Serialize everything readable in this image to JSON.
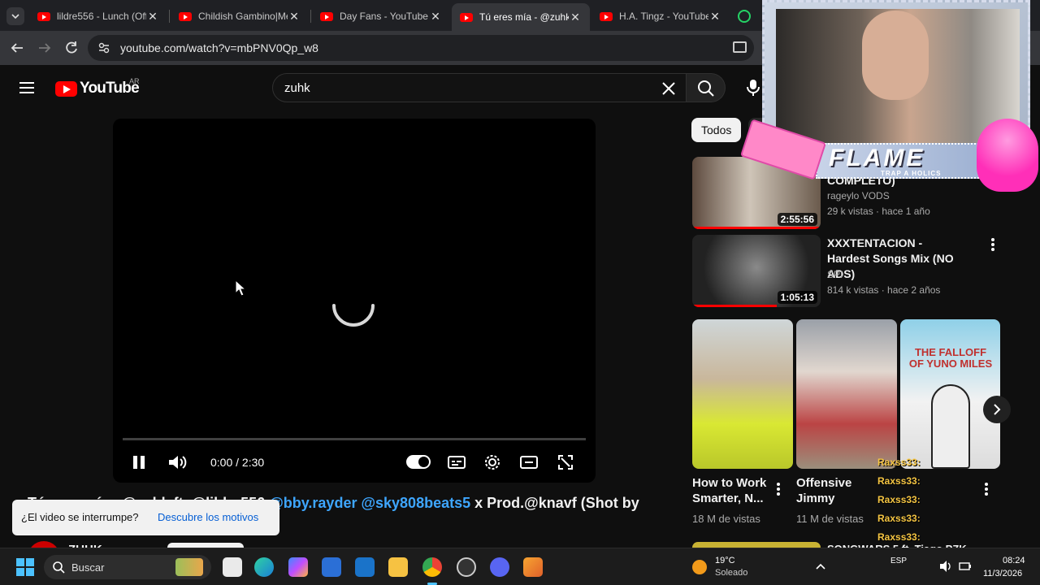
{
  "browser": {
    "tabs": [
      {
        "label": "lildre556 - Lunch (Off",
        "active": false
      },
      {
        "label": "Childish Gambino|Me",
        "active": false
      },
      {
        "label": "Day Fans - YouTube",
        "active": false
      },
      {
        "label": "Tú eres mía - @zuhk",
        "active": true
      },
      {
        "label": "H.A. Tingz - YouTube",
        "active": false
      }
    ],
    "url": "youtube.com/watch?v=mbPNV0Qp_w8"
  },
  "youtube": {
    "logo_text": "YouTube",
    "region": "AR",
    "search_value": "zuhk"
  },
  "player": {
    "time": "0:00 / 2:30",
    "progress": 0
  },
  "video": {
    "title_prefix": "Tú eres mía - @zuhk ft. @lildre556",
    "title_links": "@bby.rayder @sky808beats5",
    "title_suffix": "x Prod.@knavf (Shot by",
    "channel": "ZUHK"
  },
  "toast": {
    "message": "¿El video se interrumpe?",
    "action": "Descubre los motivos"
  },
  "sidebar": {
    "chip_all": "Todos",
    "videos": [
      {
        "title": "COMPLETO)",
        "channel": "rageylo VODS",
        "meta": "29 k vistas · hace 1 año",
        "duration": "2:55:56"
      },
      {
        "title": "XXXTENTACION - Hardest Songs Mix (NO ADS)",
        "channel": "SPI",
        "meta": "814 k vistas · hace 2 años",
        "duration": "1:05:13"
      }
    ],
    "shorts": [
      {
        "title": "How to Work Smarter, N...",
        "meta": "18 M de vistas"
      },
      {
        "title": "Offensive Jimmy",
        "meta": "11 M de vistas"
      },
      {
        "title": "The Falloff of Yuno Miles",
        "thumb_text": "THE FALLOFF OF YUNO MILES"
      }
    ],
    "next_title": "SONGWARS 5 ft. Tiago PZK"
  },
  "overlay": {
    "stream_logo": "FLAME",
    "stream_sub": "TRAP A HOLICS",
    "chat_user": "Raxss33:"
  },
  "taskbar": {
    "search_placeholder": "Buscar",
    "weather_temp": "19°C",
    "weather_desc": "Soleado",
    "lang": "ESP",
    "time": "08:24",
    "date": "11/3/2026"
  },
  "colors": {
    "yt_red": "#ff0000",
    "link_blue": "#3ea6ff",
    "chrome_dark": "#35363a",
    "accent_pink": "#ff4fc4"
  }
}
